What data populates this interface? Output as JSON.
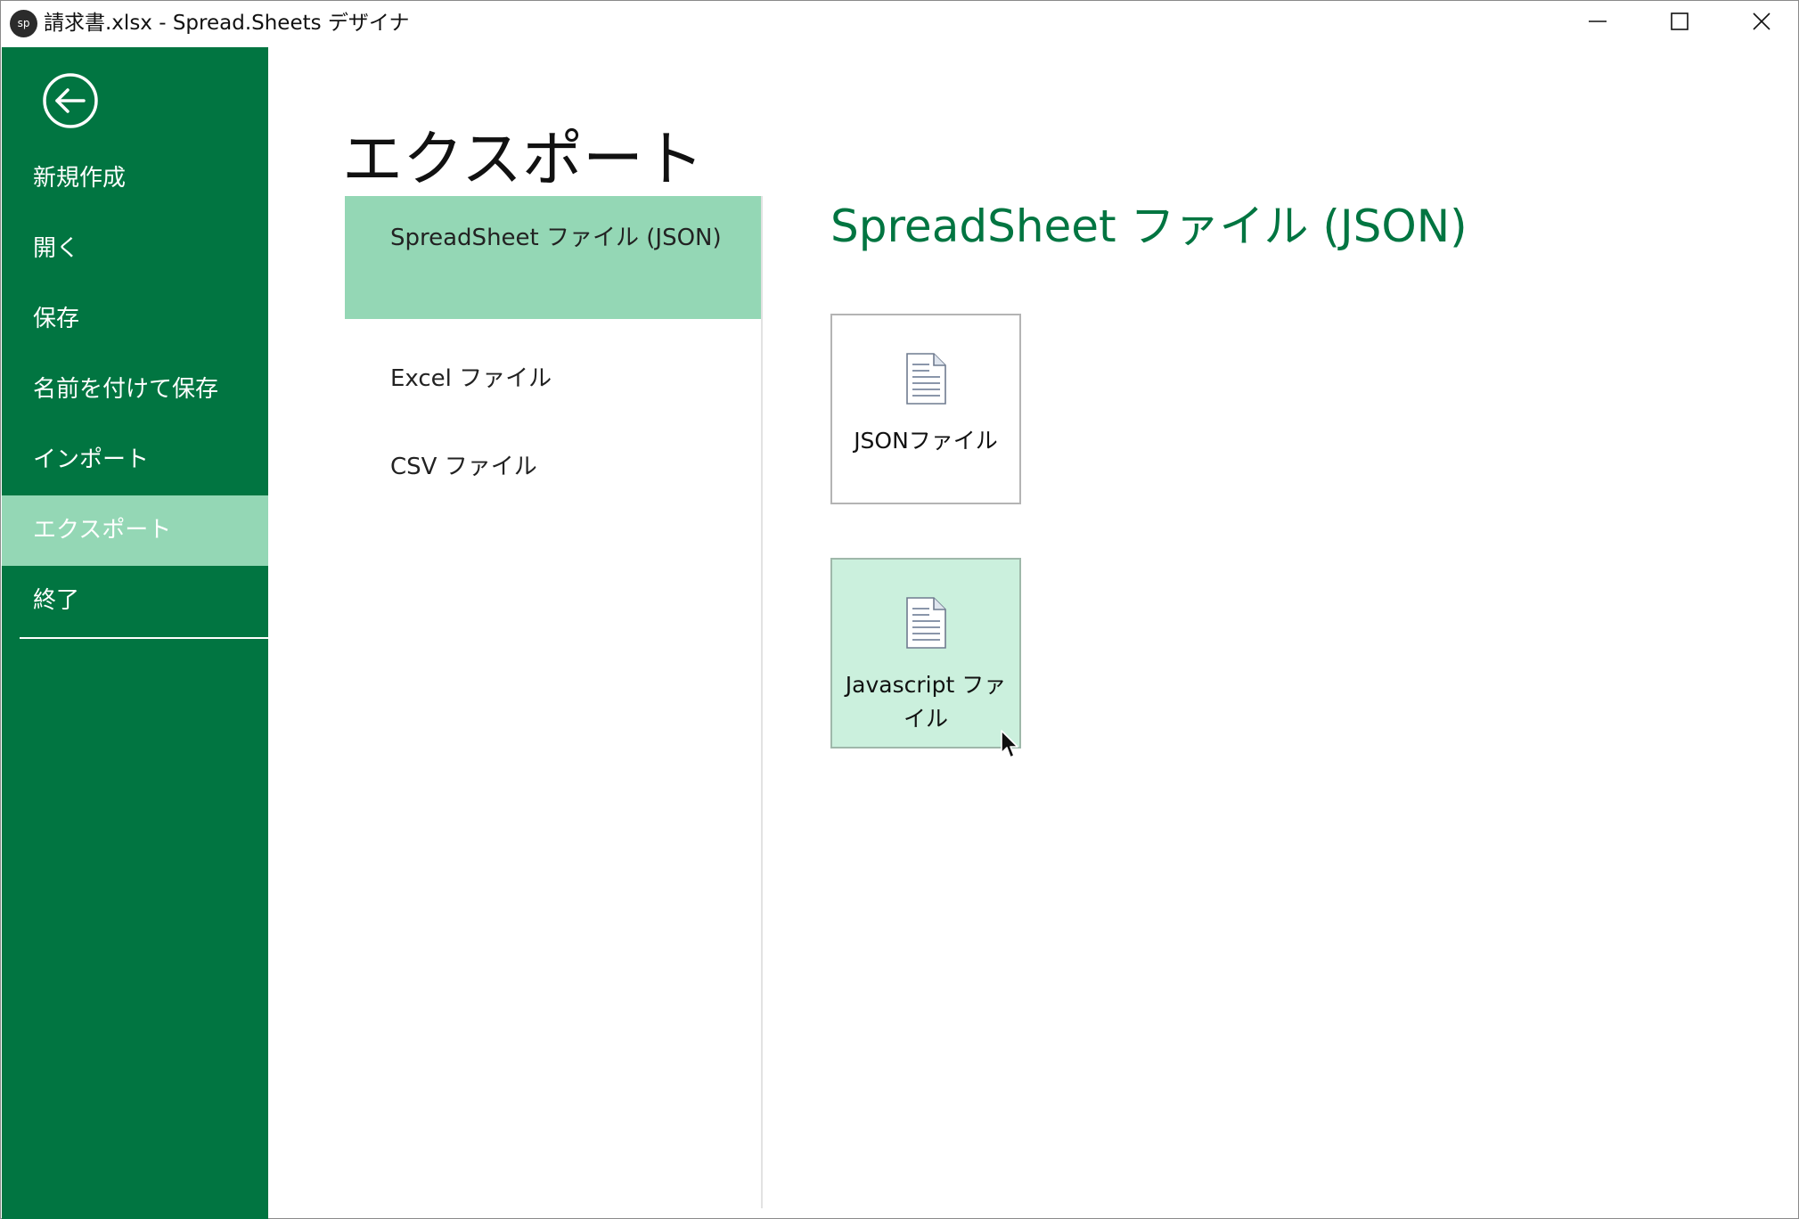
{
  "window": {
    "app_logo_text": "sp",
    "title": "請求書.xlsx - Spread.Sheets デザイナ",
    "controls": [
      "minimize",
      "maximize",
      "close"
    ]
  },
  "sidebar": {
    "back_icon": "back-arrow-circle-icon",
    "items": [
      {
        "label": "新規作成",
        "active": false
      },
      {
        "label": "開く",
        "active": false
      },
      {
        "label": "保存",
        "active": false
      },
      {
        "label": "名前を付けて保存",
        "active": false
      },
      {
        "label": "インポート",
        "active": false
      },
      {
        "label": "エクスポート",
        "active": true
      },
      {
        "label": "終了",
        "active": false
      }
    ]
  },
  "main": {
    "page_title": "エクスポート",
    "export_options": [
      {
        "label": "SpreadSheet ファイル (JSON)",
        "selected": true
      },
      {
        "label": "Excel ファイル",
        "selected": false
      },
      {
        "label": "CSV ファイル",
        "selected": false
      }
    ],
    "section_title": "SpreadSheet ファイル (JSON)",
    "tiles": [
      {
        "label": "JSONファイル",
        "icon": "document-icon",
        "hovered": false
      },
      {
        "label": "Javascript ファイル",
        "icon": "document-icon",
        "hovered": true
      }
    ]
  },
  "colors": {
    "brand_green": "#017541",
    "selected_green": "#94d7b5",
    "hover_green": "#cbf0dd"
  }
}
